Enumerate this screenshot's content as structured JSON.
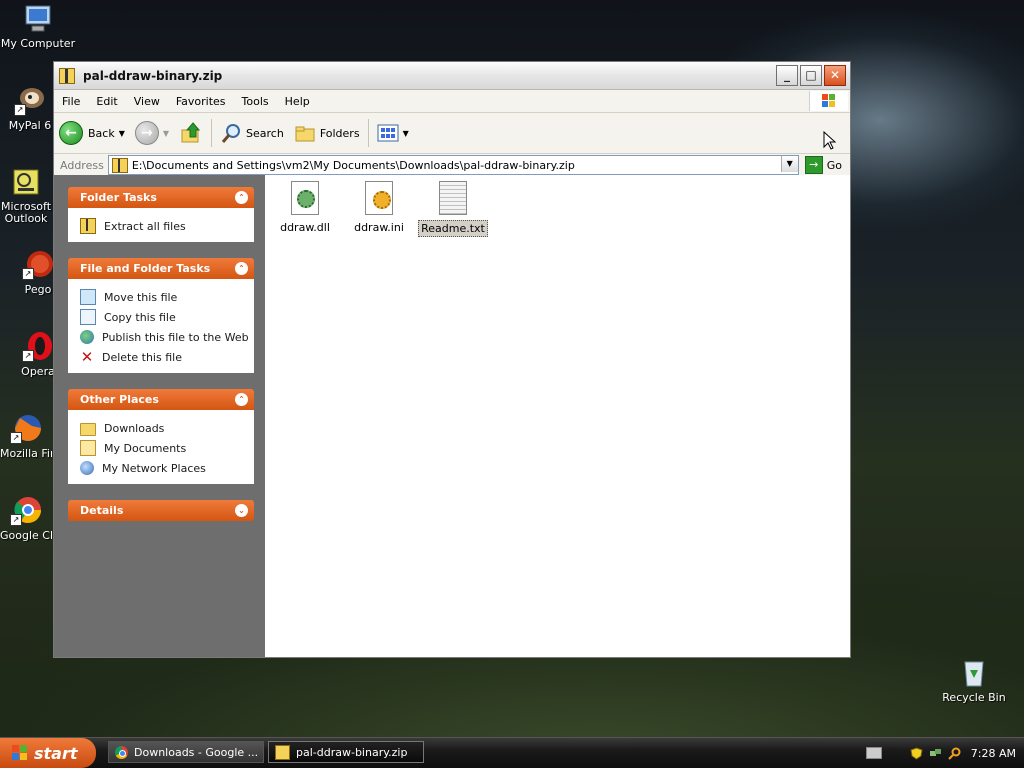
{
  "desktop": {
    "icons": [
      {
        "label": "My Computer"
      },
      {
        "label": "MyPal 6"
      },
      {
        "label": "Microsoft Outlook"
      },
      {
        "label": "Pego"
      },
      {
        "label": "Opera"
      },
      {
        "label": "Mozilla Firefox"
      },
      {
        "label": "Google Chrome"
      },
      {
        "label": "Recycle Bin"
      }
    ]
  },
  "window": {
    "title": "pal-ddraw-binary.zip",
    "menu": [
      "File",
      "Edit",
      "View",
      "Favorites",
      "Tools",
      "Help"
    ],
    "toolbar": {
      "back_label": "Back",
      "search_label": "Search",
      "folders_label": "Folders"
    },
    "address": {
      "label": "Address",
      "value": "E:\\Documents and Settings\\vm2\\My Documents\\Downloads\\pal-ddraw-binary.zip",
      "go_label": "Go"
    },
    "tasks": {
      "folder_tasks": {
        "title": "Folder Tasks",
        "items": [
          "Extract all files"
        ]
      },
      "file_tasks": {
        "title": "File and Folder Tasks",
        "items": [
          "Move this file",
          "Copy this file",
          "Publish this file to the Web",
          "Delete this file"
        ]
      },
      "other_places": {
        "title": "Other Places",
        "items": [
          "Downloads",
          "My Documents",
          "My Network Places"
        ]
      },
      "details": {
        "title": "Details"
      }
    },
    "files": [
      {
        "name": "ddraw.dll"
      },
      {
        "name": "ddraw.ini"
      },
      {
        "name": "Readme.txt"
      }
    ]
  },
  "taskbar": {
    "start_label": "start",
    "items": [
      {
        "label": "Downloads - Google ..."
      },
      {
        "label": "pal-ddraw-binary.zip"
      }
    ],
    "clock": "7:28 AM"
  },
  "colors": {
    "taskpane_header": "#e0641e",
    "taskpane_bg": "#6e6e6e",
    "start_button": "#d85a18"
  }
}
